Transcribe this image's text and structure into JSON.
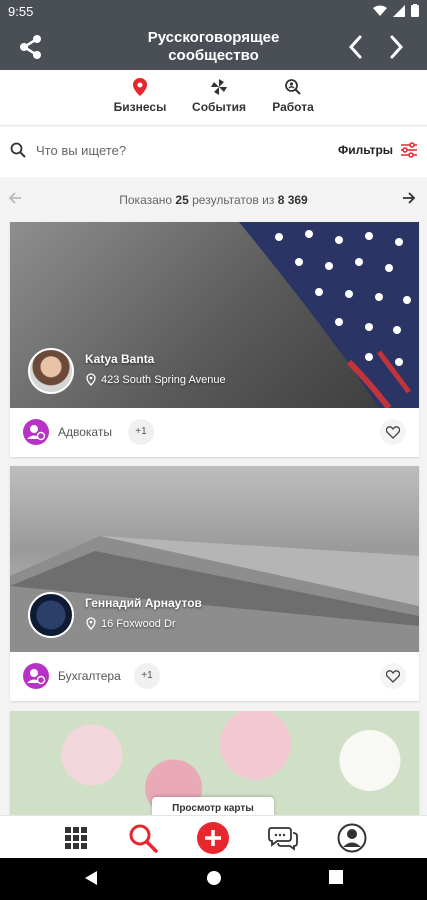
{
  "status": {
    "time": "9:55"
  },
  "header": {
    "title": "Русскоговорящее сообщество",
    "icons": [
      "share-icon",
      "chevron-left-icon",
      "chevron-right-icon"
    ]
  },
  "tabs": [
    {
      "label": "Бизнесы",
      "icon": "map-pin-icon",
      "color": "#e8262e"
    },
    {
      "label": "События",
      "icon": "pinwheel-icon"
    },
    {
      "label": "Работа",
      "icon": "job-search-icon"
    }
  ],
  "search": {
    "placeholder": "Что вы ищете?",
    "filters_label": "Фильтры"
  },
  "results": {
    "prefix": "Показано",
    "shown": "25",
    "middle": "результатов из",
    "total": "8 369"
  },
  "listings": [
    {
      "name": "Katya Banta",
      "address": "423 South Spring Avenue",
      "category": "Адвокаты",
      "extra": "+1"
    },
    {
      "name": "Геннадий Арнаутов",
      "address": "16 Foxwood Dr",
      "category": "Бухгалтера",
      "extra": "+1"
    }
  ],
  "map_button": {
    "label": "Просмотр карты"
  },
  "bottom_nav": [
    "grid-icon",
    "search-icon",
    "add-icon",
    "chat-icon",
    "profile-icon"
  ],
  "colors": {
    "header": "#4a4e55",
    "accent": "#e8262e",
    "category_icon": "#b832c7"
  }
}
